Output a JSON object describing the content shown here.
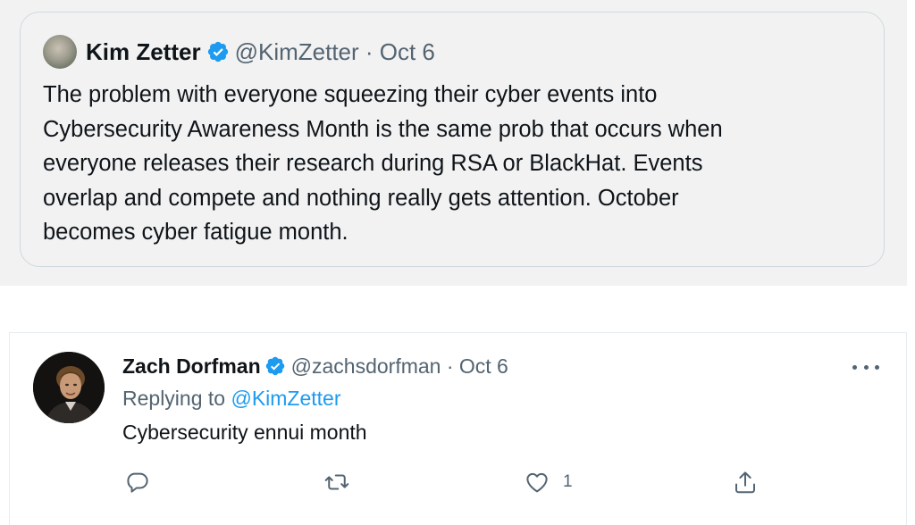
{
  "quoted_tweet": {
    "author_name": "Kim Zetter",
    "handle_date": "@KimZetter · Oct 6",
    "text_lines": [
      "The problem with everyone squeezing their cyber events into",
      "Cybersecurity Awareness Month is the same prob that occurs when",
      "everyone releases their research during RSA or BlackHat. Events",
      "overlap and compete and nothing really gets attention. October",
      "becomes cyber fatigue month."
    ]
  },
  "reply_tweet": {
    "author_name": "Zach Dorfman",
    "handle_date": "@zachsdorfman · Oct 6",
    "replying_prefix": "Replying to",
    "replying_handle": "@KimZetter",
    "text": "Cybersecurity ennui month",
    "like_count": "1",
    "icons": [
      "reply-icon",
      "retweet-icon",
      "like-icon",
      "share-icon",
      "more-icon",
      "verified-badge-icon"
    ]
  },
  "colors": {
    "accent": "#1d9bf0",
    "text_primary": "#0f1419",
    "text_secondary": "#536471",
    "border": "#cfd9de",
    "top_background": "#f2f2f2"
  }
}
